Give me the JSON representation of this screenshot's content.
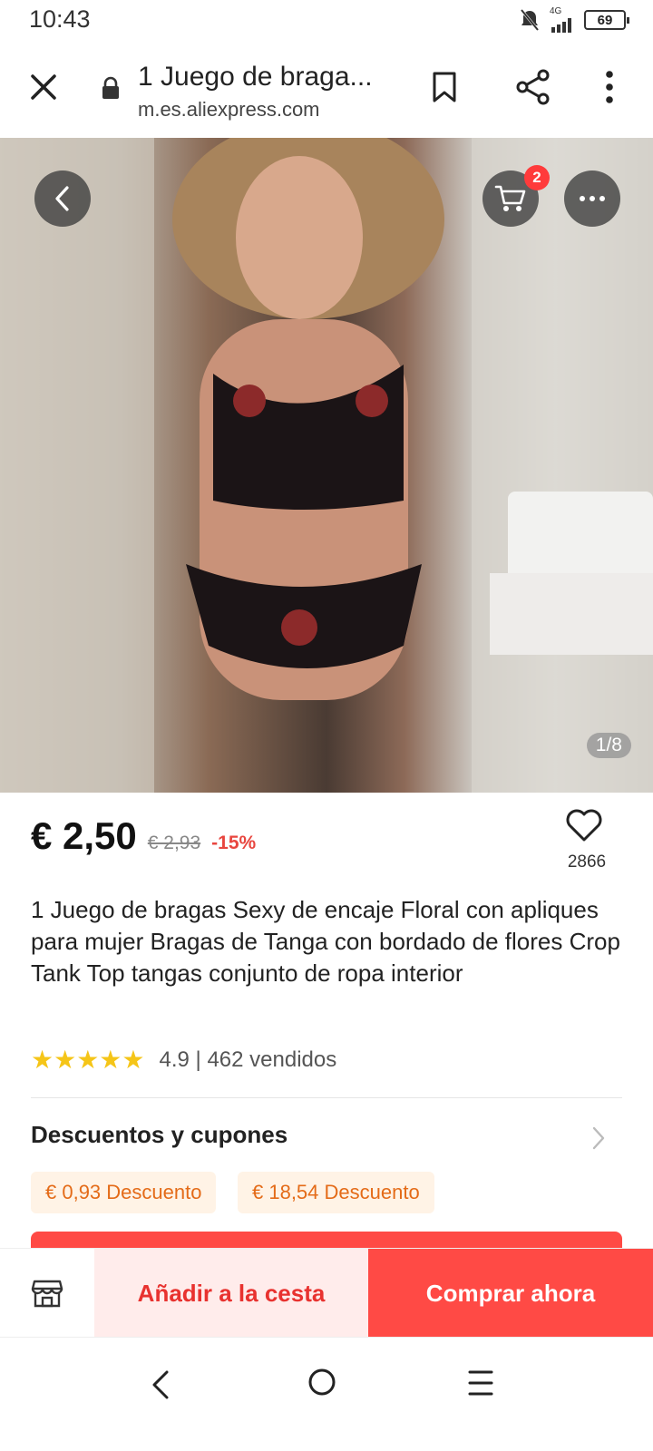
{
  "status_bar": {
    "time": "10:43",
    "network": "4G",
    "battery": "69"
  },
  "browser": {
    "tab_title": "1 Juego de braga...",
    "url": "m.es.aliexpress.com"
  },
  "gallery": {
    "cart_count": "2",
    "counter": "1/8"
  },
  "product": {
    "price": "€ 2,50",
    "original_price": "€ 2,93",
    "discount": "-15%",
    "wishlist_count": "2866",
    "title": "1 Juego de bragas Sexy de encaje Floral con apliques para mujer Bragas de Tanga con bordado de flores Crop Tank Top tangas conjunto de ropa interior",
    "rating_value": 4.9,
    "rating_text": "4.9 | 462 vendidos"
  },
  "coupons": {
    "title": "Descuentos y cupones",
    "items": [
      {
        "label": "€ 0,93 Descuento"
      },
      {
        "label": "€ 18,54 Descuento"
      }
    ]
  },
  "actions": {
    "add_to_cart": "Añadir a la cesta",
    "buy_now": "Comprar ahora"
  },
  "colors": {
    "accent_red": "#ff4a45",
    "coupon_orange": "#e46b18",
    "star_yellow": "#f5c518"
  },
  "icons": {
    "close": "close-icon",
    "lock": "lock-icon",
    "bookmark": "bookmark-icon",
    "share": "share-icon",
    "menu": "more-vertical-icon",
    "back": "chevron-left-icon",
    "cart": "cart-icon",
    "more": "more-horizontal-icon",
    "heart": "heart-icon",
    "store": "store-icon"
  }
}
